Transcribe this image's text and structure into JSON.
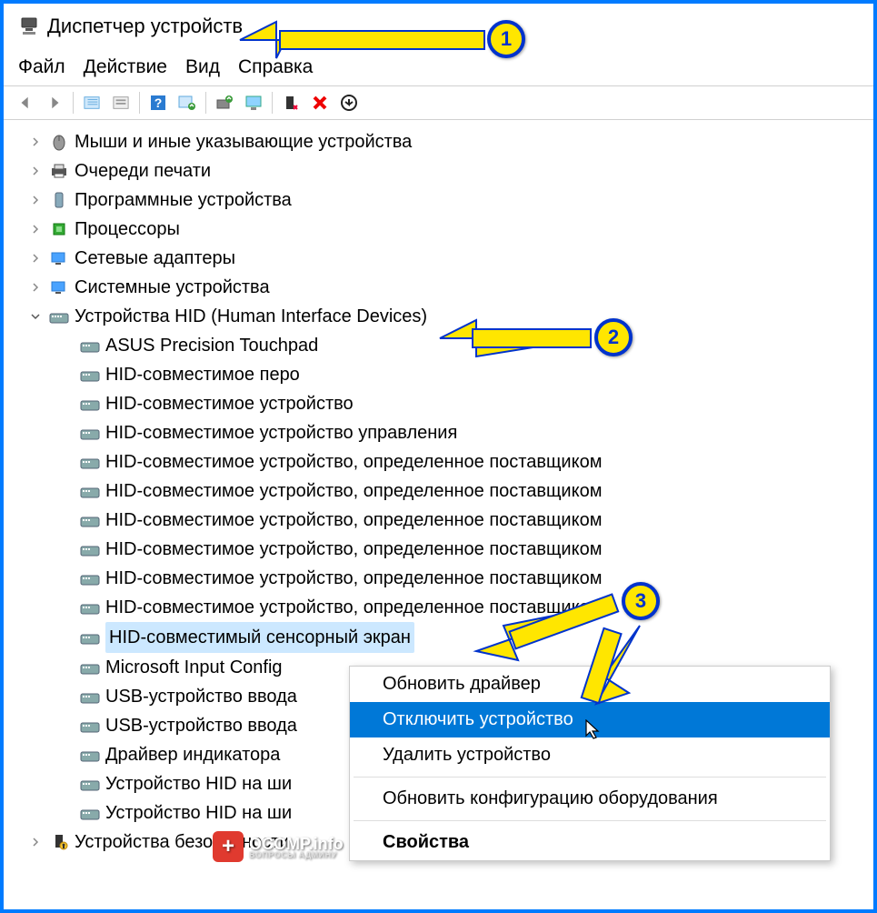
{
  "title": "Диспетчер устройств",
  "menu": {
    "file": "Файл",
    "action": "Действие",
    "view": "Вид",
    "help": "Справка"
  },
  "categories": [
    {
      "label": "Мыши и иные указывающие устройства",
      "icon": "mouse"
    },
    {
      "label": "Очереди печати",
      "icon": "printer"
    },
    {
      "label": "Программные устройства",
      "icon": "software"
    },
    {
      "label": "Процессоры",
      "icon": "cpu"
    },
    {
      "label": "Сетевые адаптеры",
      "icon": "net"
    },
    {
      "label": "Системные устройства",
      "icon": "sys"
    }
  ],
  "hid": {
    "label": "Устройства HID (Human Interface Devices)",
    "items": [
      "ASUS Precision Touchpad",
      "HID-совместимое перо",
      "HID-совместимое устройство",
      "HID-совместимое устройство управления",
      "HID-совместимое устройство, определенное поставщиком",
      "HID-совместимое устройство, определенное поставщиком",
      "HID-совместимое устройство, определенное поставщиком",
      "HID-совместимое устройство, определенное поставщиком",
      "HID-совместимое устройство, определенное поставщиком",
      "HID-совместимое устройство, определенное поставщиком",
      "HID-совместимый сенсорный экран",
      "Microsoft Input Config",
      "USB-устройство ввода",
      "USB-устройство ввода",
      "Драйвер индикатора",
      "Устройство HID на ши",
      "Устройство HID на ши"
    ],
    "selected_index": 10
  },
  "last_category": "Устройства безопасности",
  "context": {
    "update": "Обновить драйвер",
    "disable": "Отключить устройство",
    "delete": "Удалить устройство",
    "scan": "Обновить конфигурацию оборудования",
    "props": "Свойства"
  },
  "watermark": {
    "main": "OCOMP.info",
    "sub": "ВОПРОСЫ АДМИНУ"
  },
  "badges": {
    "b1": "1",
    "b2": "2",
    "b3": "3"
  }
}
